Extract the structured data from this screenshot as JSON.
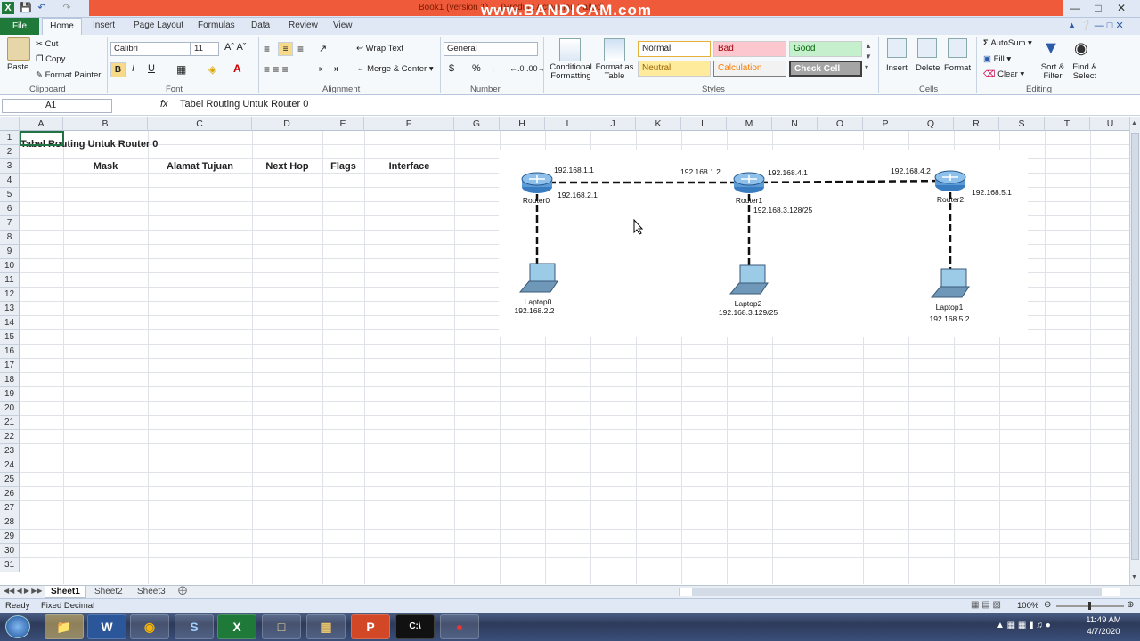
{
  "window": {
    "title": "Book1 (version 1) ... (Product Activation Failed)",
    "watermark": "www.BANDICAM.com"
  },
  "tabs": [
    "File",
    "Home",
    "Insert",
    "Page Layout",
    "Formulas",
    "Data",
    "Review",
    "View"
  ],
  "ribbon": {
    "clipboard": {
      "paste": "Paste",
      "cut": "Cut",
      "copy": "Copy",
      "format_painter": "Format Painter",
      "label": "Clipboard"
    },
    "font": {
      "name": "Calibri",
      "size": "11",
      "label": "Font",
      "bold": "B",
      "italic": "I",
      "underline": "U"
    },
    "alignment": {
      "wrap": "Wrap Text",
      "merge": "Merge & Center",
      "label": "Alignment"
    },
    "number": {
      "format": "General",
      "currency": "$",
      "percent": "%",
      "comma": ",",
      "label": "Number"
    },
    "styles": {
      "conditional": "Conditional Formatting",
      "format_table": "Format as Table",
      "normal": "Normal",
      "bad": "Bad",
      "good": "Good",
      "neutral": "Neutral",
      "calculation": "Calculation",
      "check_cell": "Check Cell",
      "label": "Styles"
    },
    "cells": {
      "insert": "Insert",
      "delete": "Delete",
      "format": "Format",
      "label": "Cells"
    },
    "editing": {
      "autosum": "AutoSum",
      "fill": "Fill",
      "clear": "Clear",
      "sort": "Sort & Filter",
      "find": "Find & Select",
      "label": "Editing"
    }
  },
  "formula_bar": {
    "name_box": "A1",
    "fx": "fx",
    "content": "Tabel Routing Untuk Router 0"
  },
  "columns": [
    "A",
    "B",
    "C",
    "D",
    "E",
    "F",
    "G",
    "H",
    "I",
    "J",
    "K",
    "L",
    "M",
    "N",
    "O",
    "P",
    "Q",
    "R",
    "S",
    "T",
    "U"
  ],
  "rows": [
    "1",
    "2",
    "3",
    "4",
    "5",
    "6",
    "7",
    "8",
    "9",
    "10",
    "11",
    "12",
    "13",
    "14",
    "15",
    "16",
    "17",
    "18",
    "19",
    "20",
    "21",
    "22",
    "23",
    "24",
    "25",
    "26",
    "27",
    "28",
    "29",
    "30",
    "31"
  ],
  "cells": {
    "a1": "Tabel Routing Untuk Router 0",
    "b2": "Mask",
    "c2": "Alamat Tujuan",
    "d2": "Next Hop",
    "e2": "Flags",
    "f2": "Interface"
  },
  "diagram": {
    "router0": "Router0",
    "router1": "Router1",
    "router2": "Router2",
    "laptop0": "Laptop0",
    "laptop2": "Laptop2",
    "laptop1": "Laptop1",
    "ip_r0_a": "192.168.1.1",
    "ip_r0_b": "192.168.2.1",
    "ip_r1_a": "192.168.1.2",
    "ip_r1_b": "192.168.4.1",
    "ip_r1_c": "192.168.3.128/25",
    "ip_r2_a": "192.168.4.2",
    "ip_r2_b": "192.168.5.1",
    "ip_l0": "192.168.2.2",
    "ip_l2": "192.168.3.129/25",
    "ip_l1": "192.168.5.2"
  },
  "sheets": [
    "Sheet1",
    "Sheet2",
    "Sheet3"
  ],
  "status": {
    "ready": "Ready",
    "mode": "Fixed Decimal",
    "zoom": "100%"
  },
  "taskbar": {
    "time": "11:49 AM",
    "date": "4/7/2020"
  }
}
